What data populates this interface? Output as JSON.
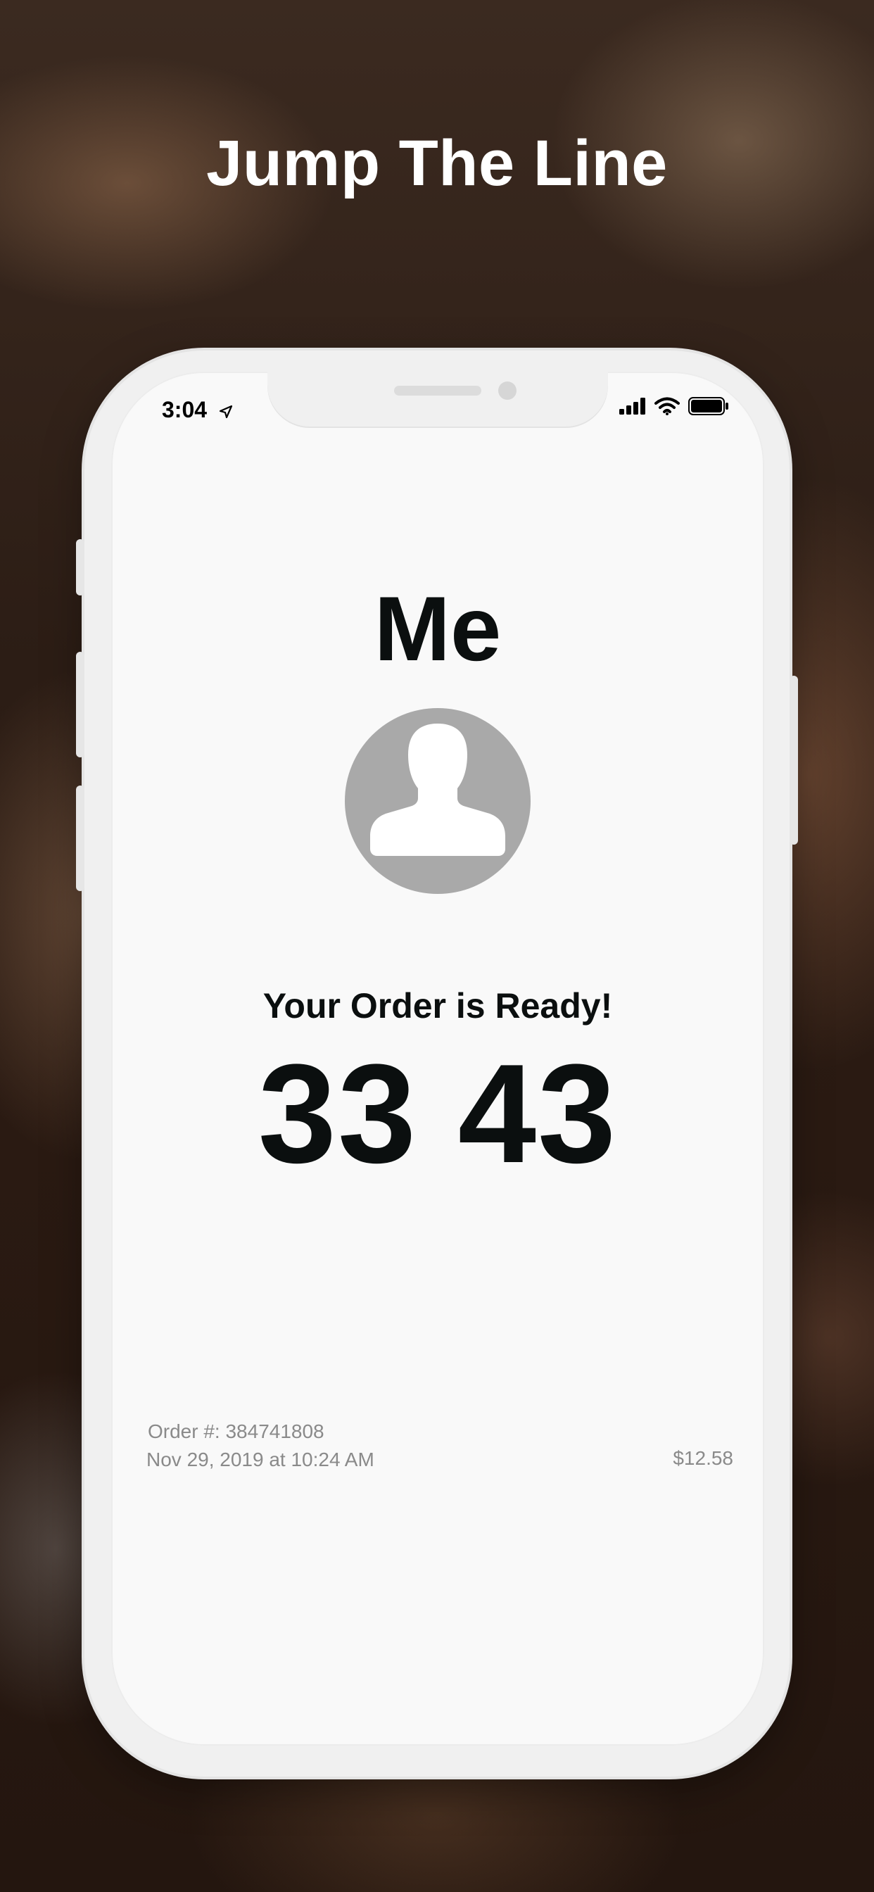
{
  "headline": "Jump The Line",
  "status_bar": {
    "time": "3:04",
    "icons": [
      "location-arrow-icon",
      "signal-bars-icon",
      "wifi-icon",
      "battery-icon"
    ]
  },
  "profile": {
    "name": "Me",
    "avatar_icon": "user-silhouette-icon"
  },
  "order": {
    "status_text": "Your Order is Ready!",
    "code": "33 43",
    "number_text": "Order #: 384741808",
    "date_text": "Nov 29, 2019 at 10:24 AM",
    "price_text": "$12.58"
  },
  "colors": {
    "text_primary": "#0b0f0f",
    "text_secondary": "#8a8a8a",
    "avatar_bg": "#a9a9a9",
    "screen_bg": "#f9f9f9"
  }
}
